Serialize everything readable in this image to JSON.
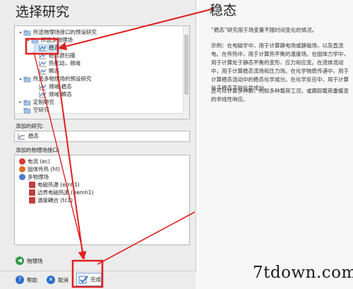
{
  "left": {
    "title": "选择研究",
    "tree": [
      {
        "label": "所选物理场接口的预设研究",
        "level": 0,
        "toggle": "▴"
      },
      {
        "label": "所选多物理场",
        "level": 1,
        "toggle": "▴"
      },
      {
        "label": "稳态",
        "level": 2,
        "selected": true
      },
      {
        "label": "稳态源扫描",
        "level": 2
      },
      {
        "label": "热扰动，频域",
        "level": 2
      },
      {
        "label": "瞬态",
        "level": 2
      },
      {
        "label": "所选多物理场的预设研究",
        "level": 0,
        "toggle": "▴"
      },
      {
        "label": "频域-稳态",
        "level": 2
      },
      {
        "label": "频域-瞬态",
        "level": 2
      },
      {
        "label": "定制研究",
        "level": 0,
        "toggle": "▸"
      },
      {
        "label": "空研究",
        "level": 0
      }
    ],
    "added_study_label": "添加的研究:",
    "added_study_value": "稳态",
    "added_physics_label": "添加的物理场接口:",
    "physics": [
      {
        "label": "电流 (ec)",
        "level": 0,
        "icon_color": "#d23c2c"
      },
      {
        "label": "固体传热 (ht)",
        "level": 0,
        "icon_color": "#e07020"
      },
      {
        "label": "多物理场",
        "level": 0,
        "icon_color": "#4a7fd0"
      },
      {
        "label": "电磁热源 (emh1)",
        "level": 1,
        "icon_color": "#c04040"
      },
      {
        "label": "边界电磁热源 (bemh1)",
        "level": 1,
        "icon_color": "#c04040"
      },
      {
        "label": "温度耦合 (tc1)",
        "level": 1,
        "icon_color": "#c04040"
      }
    ],
    "back_label": "物理场",
    "help_label": "帮助",
    "cancel_label": "取消",
    "done_label": "完成"
  },
  "right": {
    "title": "稳态",
    "desc1": "“稳态”研究用于场变量不随时间变化的情况。",
    "desc2": "示例：在电磁学中，用于计算静电场或静磁场，以及直流电。在传热中，用于计算热平衡的温度场。在固体力学中，用于计算处于静态平衡的变形、应力和应变。在流体流动中，用于计算稳态流场和压力场。在化学物质传递中，用于计算稳态流动中的稳态化学成分。在化学反应中，用于计算处于稳态下的化学成分。",
    "desc3": "还可以计算多种解，例如多种载荷工况，或跟踪载荷重缓变的非线性响应。"
  },
  "watermark": "7tdown.com",
  "colors": {
    "accent": "#e02020",
    "selection": "#cde3f7"
  }
}
